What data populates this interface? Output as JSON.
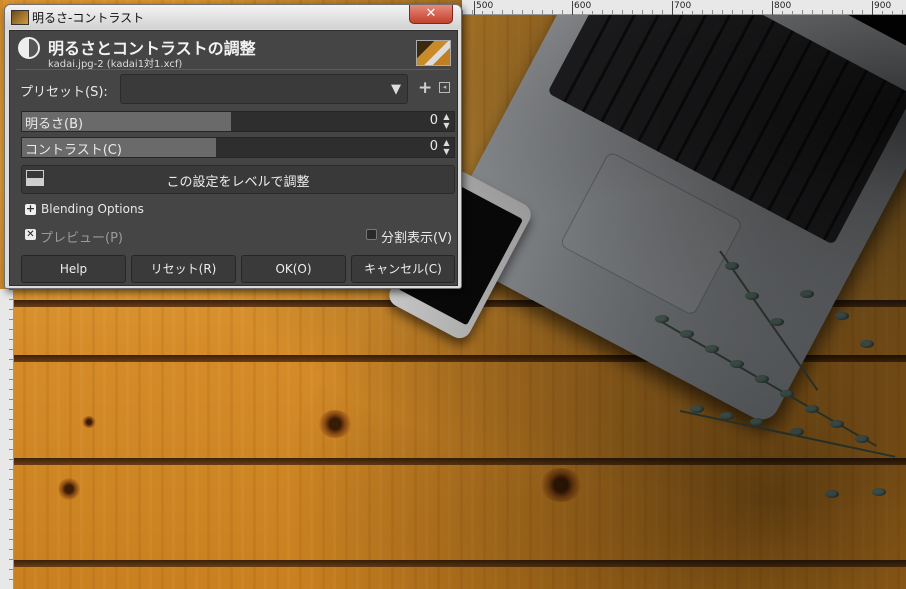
{
  "ruler": {
    "top_labels": [
      "500",
      "600",
      "700",
      "800",
      "900"
    ]
  },
  "dialog": {
    "window_title": "明るさ-コントラスト",
    "close_symbol": "✕",
    "header_title": "明るさとコントラストの調整",
    "header_subtitle": "kadai.jpg-2 (kadai1対1.xcf)",
    "preset": {
      "label": "プリセット(S):",
      "value": "",
      "add_symbol": "+",
      "menu_symbol": "◂"
    },
    "brightness": {
      "label": "明るさ(B)",
      "value": "0"
    },
    "contrast": {
      "label": "コントラスト(C)",
      "value": "0"
    },
    "levels_button": "この設定をレベルで調整",
    "blending_options": "Blending Options",
    "preview": {
      "label": "プレビュー(P)",
      "checked": true
    },
    "split_view": {
      "label": "分割表示(V)",
      "checked": false
    },
    "buttons": {
      "help": "Help",
      "reset": "リセット(R)",
      "ok": "OK(O)",
      "cancel": "キャンセル(C)"
    }
  },
  "colors": {
    "dialog_bg": "#454545",
    "wood": "#d9942f"
  }
}
